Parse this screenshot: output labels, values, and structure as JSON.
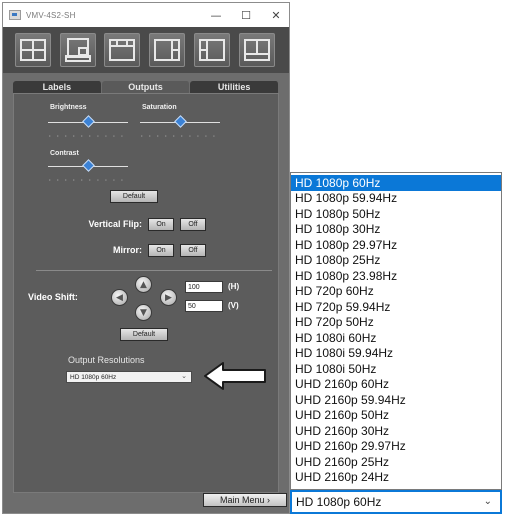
{
  "window": {
    "title": "VMV-4S2-SH",
    "controls": {
      "minimize": "—",
      "maximize": "☐",
      "close": "✕"
    }
  },
  "toolbar": {
    "layouts": [
      "quad-layout-icon",
      "pip-layout-icon",
      "triple-layout-icon",
      "side-by-side-layout-icon",
      "split-layout-icon",
      "quad-alt-layout-icon"
    ]
  },
  "tabs": [
    {
      "label": "Labels",
      "active": false
    },
    {
      "label": "Outputs",
      "active": true
    },
    {
      "label": "Utilities",
      "active": false
    }
  ],
  "outputs": {
    "brightness": {
      "label": "Brightness",
      "level": 0.5
    },
    "saturation": {
      "label": "Saturation",
      "level": 0.5
    },
    "contrast": {
      "label": "Contrast",
      "level": 0.5
    },
    "default_label": "Default",
    "vertical_flip": {
      "label": "Vertical Flip:",
      "on": "On",
      "off": "Off"
    },
    "mirror": {
      "label": "Mirror:",
      "on": "On",
      "off": "Off"
    },
    "video_shift": {
      "label": "Video Shift:",
      "h_value": "100",
      "h_unit": "(H)",
      "v_value": "50",
      "v_unit": "(V)",
      "default_label": "Default"
    },
    "output_resolutions": {
      "label": "Output Resolutions",
      "selected": "HD 1080p 60Hz"
    },
    "main_menu_label": "Main Menu ›"
  },
  "dropdown": {
    "options": [
      "HD 1080p 60Hz",
      "HD 1080p 59.94Hz",
      "HD 1080p 50Hz",
      "HD 1080p 30Hz",
      "HD 1080p 29.97Hz",
      "HD 1080p 25Hz",
      "HD 1080p 23.98Hz",
      "HD 720p 60Hz",
      "HD 720p 59.94Hz",
      "HD 720p 50Hz",
      "HD 1080i 60Hz",
      "HD 1080i 59.94Hz",
      "HD 1080i 50Hz",
      "UHD 2160p  60Hz",
      "UHD 2160p  59.94Hz",
      "UHD 2160p  50Hz",
      "UHD 2160p  30Hz",
      "UHD 2160p  29.97Hz",
      "UHD 2160p  25Hz",
      "UHD 2160p  24Hz"
    ],
    "selected_index": 0,
    "current_value": "HD 1080p 60Hz"
  },
  "colors": {
    "highlight": "#0b78d7",
    "slider_thumb": "#3b82d6",
    "panel": "#5c5c5c"
  }
}
